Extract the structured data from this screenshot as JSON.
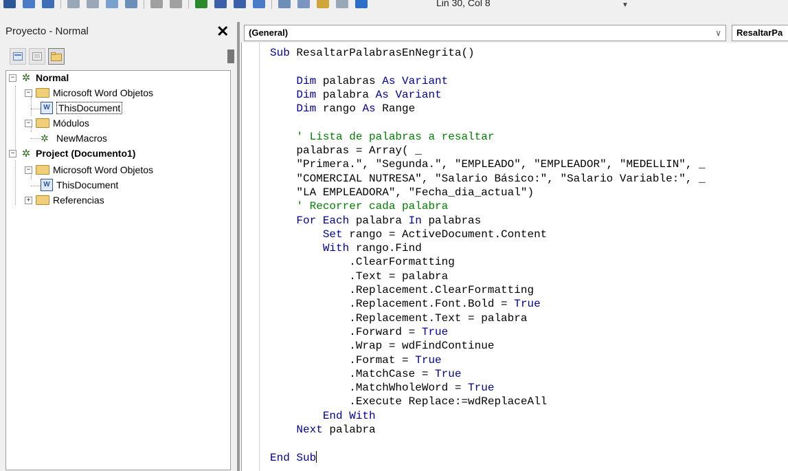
{
  "toolbar": {
    "position_text": "Lin 30, Col 8",
    "buttons": [
      "view-word-icon",
      "insert-icon",
      "save-icon",
      "cut-icon",
      "copy-icon",
      "paste-icon",
      "find-icon",
      "undo-icon",
      "redo-icon",
      "run-icon",
      "break-icon",
      "reset-icon",
      "design-mode-icon",
      "project-explorer-icon",
      "properties-icon",
      "object-browser-icon",
      "toolbox-icon",
      "help-icon"
    ]
  },
  "project": {
    "title": "Proyecto - Normal",
    "close_label": "✕",
    "tree": {
      "normal": "Normal",
      "normal_objects": "Microsoft Word Objetos",
      "normal_thisdoc": "ThisDocument",
      "modules": "Módulos",
      "newmacros": "NewMacros",
      "project_doc": "Project (Documento1)",
      "doc_objects": "Microsoft Word Objetos",
      "doc_thisdoc": "ThisDocument",
      "references": "Referencias"
    }
  },
  "code_window": {
    "object_combo": "(General)",
    "procedure_combo": "ResaltarPa",
    "lines": [
      [
        [
          "kw",
          "Sub"
        ],
        [
          "t",
          " ResaltarPalabrasEnNegrita()"
        ]
      ],
      [],
      [
        [
          "t",
          "    "
        ],
        [
          "kw",
          "Dim"
        ],
        [
          "t",
          " palabras "
        ],
        [
          "kw",
          "As"
        ],
        [
          "t",
          " "
        ],
        [
          "kw",
          "Variant"
        ]
      ],
      [
        [
          "t",
          "    "
        ],
        [
          "kw",
          "Dim"
        ],
        [
          "t",
          " palabra "
        ],
        [
          "kw",
          "As"
        ],
        [
          "t",
          " "
        ],
        [
          "kw",
          "Variant"
        ]
      ],
      [
        [
          "t",
          "    "
        ],
        [
          "kw",
          "Dim"
        ],
        [
          "t",
          " rango "
        ],
        [
          "kw",
          "As"
        ],
        [
          "t",
          " Range"
        ]
      ],
      [],
      [
        [
          "t",
          "    "
        ],
        [
          "cm",
          "' Lista de palabras a resaltar"
        ]
      ],
      [
        [
          "t",
          "    palabras = Array( _"
        ]
      ],
      [
        [
          "t",
          "    \"Primera.\", \"Segunda.\", \"EMPLEADO\", \"EMPLEADOR\", \"MEDELLIN\", _"
        ]
      ],
      [
        [
          "t",
          "    \"COMERCIAL NUTRESA\", \"Salario Básico:\", \"Salario Variable:\", _"
        ]
      ],
      [
        [
          "t",
          "    \"LA EMPLEADORA\", \"Fecha_dia_actual\")"
        ]
      ],
      [
        [
          "t",
          "    "
        ],
        [
          "cm",
          "' Recorrer cada palabra"
        ]
      ],
      [
        [
          "t",
          "    "
        ],
        [
          "kw",
          "For Each"
        ],
        [
          "t",
          " palabra "
        ],
        [
          "kw",
          "In"
        ],
        [
          "t",
          " palabras"
        ]
      ],
      [
        [
          "t",
          "        "
        ],
        [
          "kw",
          "Set"
        ],
        [
          "t",
          " rango = ActiveDocument.Content"
        ]
      ],
      [
        [
          "t",
          "        "
        ],
        [
          "kw",
          "With"
        ],
        [
          "t",
          " rango.Find"
        ]
      ],
      [
        [
          "t",
          "            .ClearFormatting"
        ]
      ],
      [
        [
          "t",
          "            .Text = palabra"
        ]
      ],
      [
        [
          "t",
          "            .Replacement.ClearFormatting"
        ]
      ],
      [
        [
          "t",
          "            .Replacement.Font.Bold = "
        ],
        [
          "kw",
          "True"
        ]
      ],
      [
        [
          "t",
          "            .Replacement.Text = palabra"
        ]
      ],
      [
        [
          "t",
          "            .Forward = "
        ],
        [
          "kw",
          "True"
        ]
      ],
      [
        [
          "t",
          "            .Wrap = wdFindContinue"
        ]
      ],
      [
        [
          "t",
          "            .Format = "
        ],
        [
          "kw",
          "True"
        ]
      ],
      [
        [
          "t",
          "            .MatchCase = "
        ],
        [
          "kw",
          "True"
        ]
      ],
      [
        [
          "t",
          "            .MatchWholeWord = "
        ],
        [
          "kw",
          "True"
        ]
      ],
      [
        [
          "t",
          "            .Execute Replace:=wdReplaceAll"
        ]
      ],
      [
        [
          "t",
          "        "
        ],
        [
          "kw",
          "End With"
        ]
      ],
      [
        [
          "t",
          "    "
        ],
        [
          "kw",
          "Next"
        ],
        [
          "t",
          " palabra"
        ]
      ],
      [],
      [
        [
          "kw",
          "End Sub"
        ],
        [
          "caret",
          ""
        ]
      ]
    ]
  }
}
